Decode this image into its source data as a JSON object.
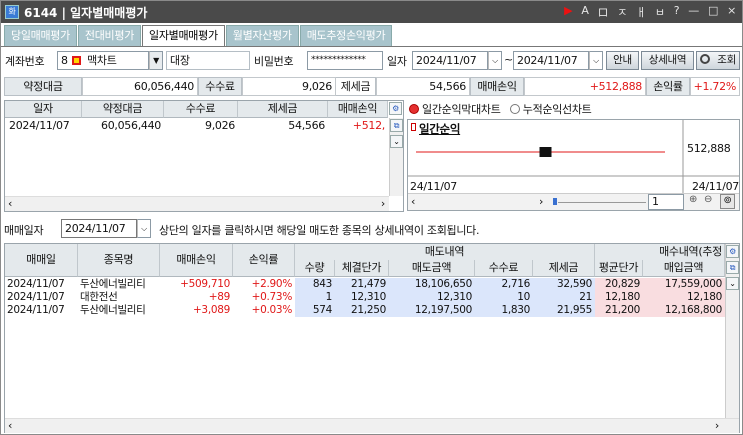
{
  "window": {
    "icon_text": "화",
    "title": "6144 | 일자별매매평가",
    "controls": [
      "▶",
      "A",
      "ロ",
      "ㅈ",
      "ㅐ",
      "ㅂ",
      "?",
      "—",
      "□",
      "×"
    ]
  },
  "tabs": [
    "당일매매평가",
    "전대비평가",
    "일자별매매평가",
    "월별자산평가",
    "매도추정손익평가"
  ],
  "active_tab": "일자별매매평가",
  "filter": {
    "account_label": "계좌번호",
    "account_value": "8",
    "account_type": "맥차트",
    "account_owner": "대장",
    "password_label": "비밀번호",
    "password_value": "*************",
    "date_label": "일자",
    "date_from": "2024/11/07",
    "date_sep": "~",
    "date_to": "2024/11/07",
    "guide_button": "안내",
    "detail_button": "상세내역",
    "search_button": "조회"
  },
  "summary": {
    "contract_label": "약정대금",
    "contract_value": "60,056,440",
    "fee_label": "수수료",
    "fee_value": "9,026",
    "tax_label": "제세금",
    "tax_value": "54,566",
    "pnl_label": "매매손익",
    "pnl_value": "+512,888",
    "rate_label": "손익률",
    "rate_value": "+1.72%"
  },
  "daily_table": {
    "headers": [
      "일자",
      "약정대금",
      "수수료",
      "제세금",
      "매매손익"
    ],
    "rows": [
      {
        "date": "2024/11/07",
        "contract": "60,056,440",
        "fee": "9,026",
        "tax": "54,566",
        "pnl": "+512,"
      }
    ]
  },
  "chart_options": {
    "option1": "일간순익막대차트",
    "option2": "누적순익선차트",
    "selected": "option1"
  },
  "chart_data": {
    "type": "bar",
    "title": "일간순익",
    "categories": [
      "24/11/07"
    ],
    "values": [
      512888
    ],
    "x_start_label": "24/11/07",
    "x_end_label": "24/11/07",
    "value_label": "512,888",
    "page_value": "1"
  },
  "detail_filter": {
    "label": "매매일자",
    "date": "2024/11/07",
    "hint": "상단의 일자를 클릭하시면 해당일 매도한 종목의 상세내역이 조회됩니다."
  },
  "detail_table": {
    "left_headers": [
      "매매일",
      "종목명",
      "매매손익",
      "손익률"
    ],
    "sell_group": "매도내역",
    "sell_headers": [
      "수량",
      "체결단가",
      "매도금액",
      "수수료",
      "제세금"
    ],
    "buy_group": "매수내역(추정",
    "buy_headers": [
      "평균단가",
      "매입금액"
    ],
    "rows": [
      {
        "date": "2024/11/07",
        "name": "두산에너빌리티",
        "pnl": "+509,710",
        "rate": "+2.90%",
        "qty": "843",
        "price": "21,479",
        "sell_amt": "18,106,650",
        "fee": "2,716",
        "tax": "32,590",
        "avg": "20,829",
        "buy_amt": "17,559,000"
      },
      {
        "date": "2024/11/07",
        "name": "대한전선",
        "pnl": "+89",
        "rate": "+0.73%",
        "qty": "1",
        "price": "12,310",
        "sell_amt": "12,310",
        "fee": "10",
        "tax": "21",
        "avg": "12,180",
        "buy_amt": "12,180"
      },
      {
        "date": "2024/11/07",
        "name": "두산에너빌리티",
        "pnl": "+3,089",
        "rate": "+0.03%",
        "qty": "574",
        "price": "21,250",
        "sell_amt": "12,197,500",
        "fee": "1,830",
        "tax": "21,955",
        "avg": "21,200",
        "buy_amt": "12,168,800"
      }
    ]
  }
}
